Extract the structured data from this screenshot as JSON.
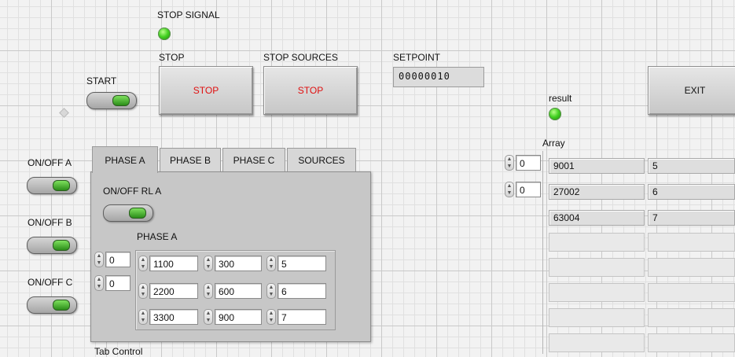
{
  "top": {
    "stop_signal_label": "STOP SIGNAL",
    "start_label": "START",
    "stop_label": "STOP",
    "stop_button_text": "STOP",
    "stop_sources_label": "STOP SOURCES",
    "stop_sources_button_text": "STOP",
    "setpoint_label": "SETPOINT",
    "setpoint_value": "00000010",
    "result_label": "result",
    "exit_label": "EXIT"
  },
  "switches": {
    "on_off_a": "ON/OFF A",
    "on_off_b": "ON/OFF B",
    "on_off_c": "ON/OFF C"
  },
  "tab_control": {
    "caption": "Tab Control",
    "tabs": [
      "PHASE A",
      "PHASE B",
      "PHASE C",
      "SOURCES"
    ],
    "on_off_rl_label": "ON/OFF RL A",
    "array_label": "PHASE A",
    "index_0": "0",
    "index_1": "0",
    "rows": [
      [
        "1100",
        "300",
        "5"
      ],
      [
        "2200",
        "600",
        "6"
      ],
      [
        "3300",
        "900",
        "7"
      ]
    ]
  },
  "result_array": {
    "label": "Array",
    "index_0": "0",
    "index_1": "0",
    "rows": [
      [
        "9001",
        "5"
      ],
      [
        "27002",
        "6"
      ],
      [
        "63004",
        "7"
      ]
    ]
  },
  "colors": {
    "stop_text": "#e01010",
    "led_green": "#42d021",
    "panel_gray": "#c7c7c7"
  }
}
